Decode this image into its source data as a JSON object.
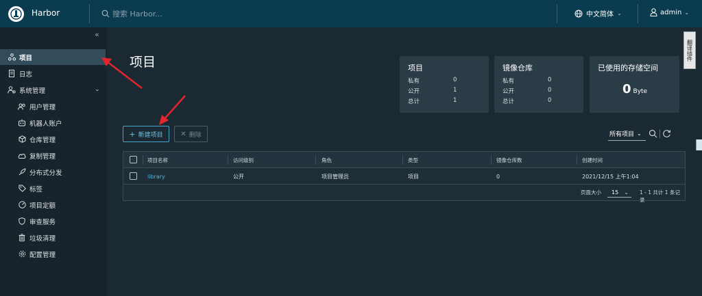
{
  "header": {
    "brand": "Harbor",
    "search_placeholder": "搜索 Harbor...",
    "language": "中文简体",
    "user": "admin"
  },
  "sidebar": {
    "items": [
      {
        "label": "项目",
        "icon": "project-icon",
        "active": true
      },
      {
        "label": "日志",
        "icon": "log-icon"
      },
      {
        "label": "系统管理",
        "icon": "admin-icon",
        "expanded": true
      },
      {
        "label": "用户管理",
        "icon": "users-icon"
      },
      {
        "label": "机器人账户",
        "icon": "robot-icon"
      },
      {
        "label": "仓库管理",
        "icon": "registry-icon"
      },
      {
        "label": "复制管理",
        "icon": "replication-icon"
      },
      {
        "label": "分布式分发",
        "icon": "distribution-icon"
      },
      {
        "label": "标签",
        "icon": "tag-icon"
      },
      {
        "label": "项目定额",
        "icon": "quota-icon"
      },
      {
        "label": "审查服务",
        "icon": "shield-icon"
      },
      {
        "label": "垃圾清理",
        "icon": "trash-icon"
      },
      {
        "label": "配置管理",
        "icon": "gear-icon"
      }
    ]
  },
  "main": {
    "title": "项目",
    "cards": {
      "projects": {
        "title": "项目",
        "rows": [
          {
            "label": "私有",
            "value": "0"
          },
          {
            "label": "公开",
            "value": "1"
          },
          {
            "label": "总计",
            "value": "1"
          }
        ]
      },
      "repos": {
        "title": "镜像仓库",
        "rows": [
          {
            "label": "私有",
            "value": "0"
          },
          {
            "label": "公开",
            "value": "0"
          },
          {
            "label": "总计",
            "value": "0"
          }
        ]
      },
      "storage": {
        "title": "已使用的存储空间",
        "value": "0",
        "unit": "Byte"
      }
    },
    "buttons": {
      "new_project": "新建项目",
      "delete": "删除"
    },
    "filter": "所有项目",
    "table": {
      "headers": [
        "项目名称",
        "访问级别",
        "角色",
        "类型",
        "镜像仓库数",
        "创建时间"
      ],
      "rows": [
        [
          "library",
          "公开",
          "项目管理员",
          "项目",
          "0",
          "2021/12/15 上午1:04"
        ]
      ],
      "footer": {
        "page_size_label": "页面大小",
        "page_size": "15",
        "summary": "1 - 1 共计 1 条记录"
      }
    }
  },
  "side_tab": "翻译插件",
  "colors": {
    "accent": "#58b6e6",
    "header": "#0b3b4e",
    "annotation": "#e3262d"
  }
}
